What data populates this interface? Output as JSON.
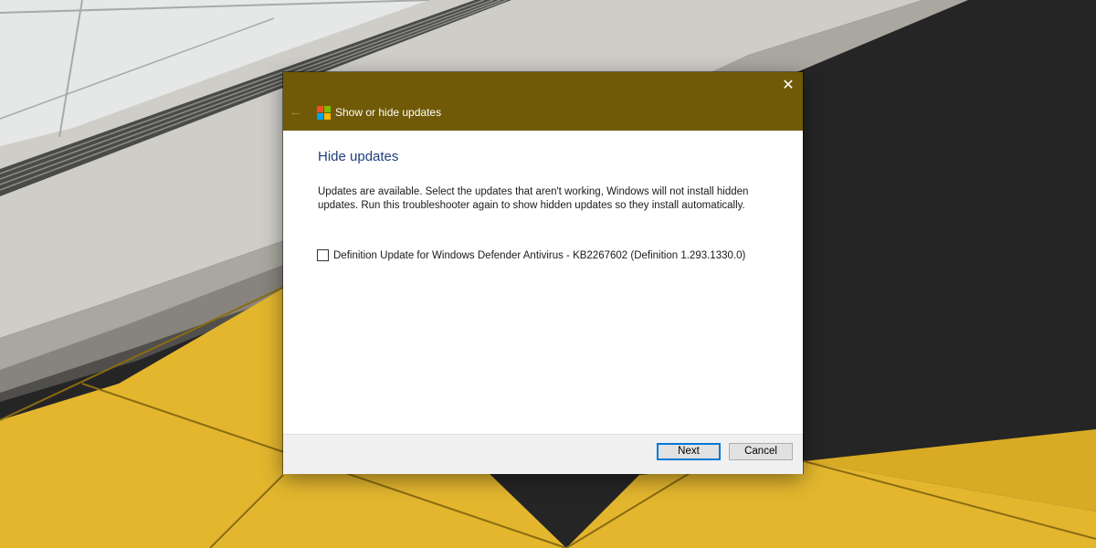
{
  "window": {
    "title": "Show or hide updates",
    "close_icon": "close-icon",
    "back_icon": "back-arrow-icon",
    "logo_icon": "windows-logo-icon",
    "titlebar_color": "#705a07"
  },
  "content": {
    "heading": "Hide updates",
    "description": "Updates are available. Select the updates that aren't working, Windows will not install hidden updates. Run this troubleshooter again to show hidden updates so they install automatically.",
    "updates": [
      {
        "label": "Definition Update for Windows Defender Antivirus - KB2267602 (Definition 1.293.1330.0)",
        "checked": false
      }
    ]
  },
  "footer": {
    "next_label": "Next",
    "cancel_label": "Cancel"
  }
}
